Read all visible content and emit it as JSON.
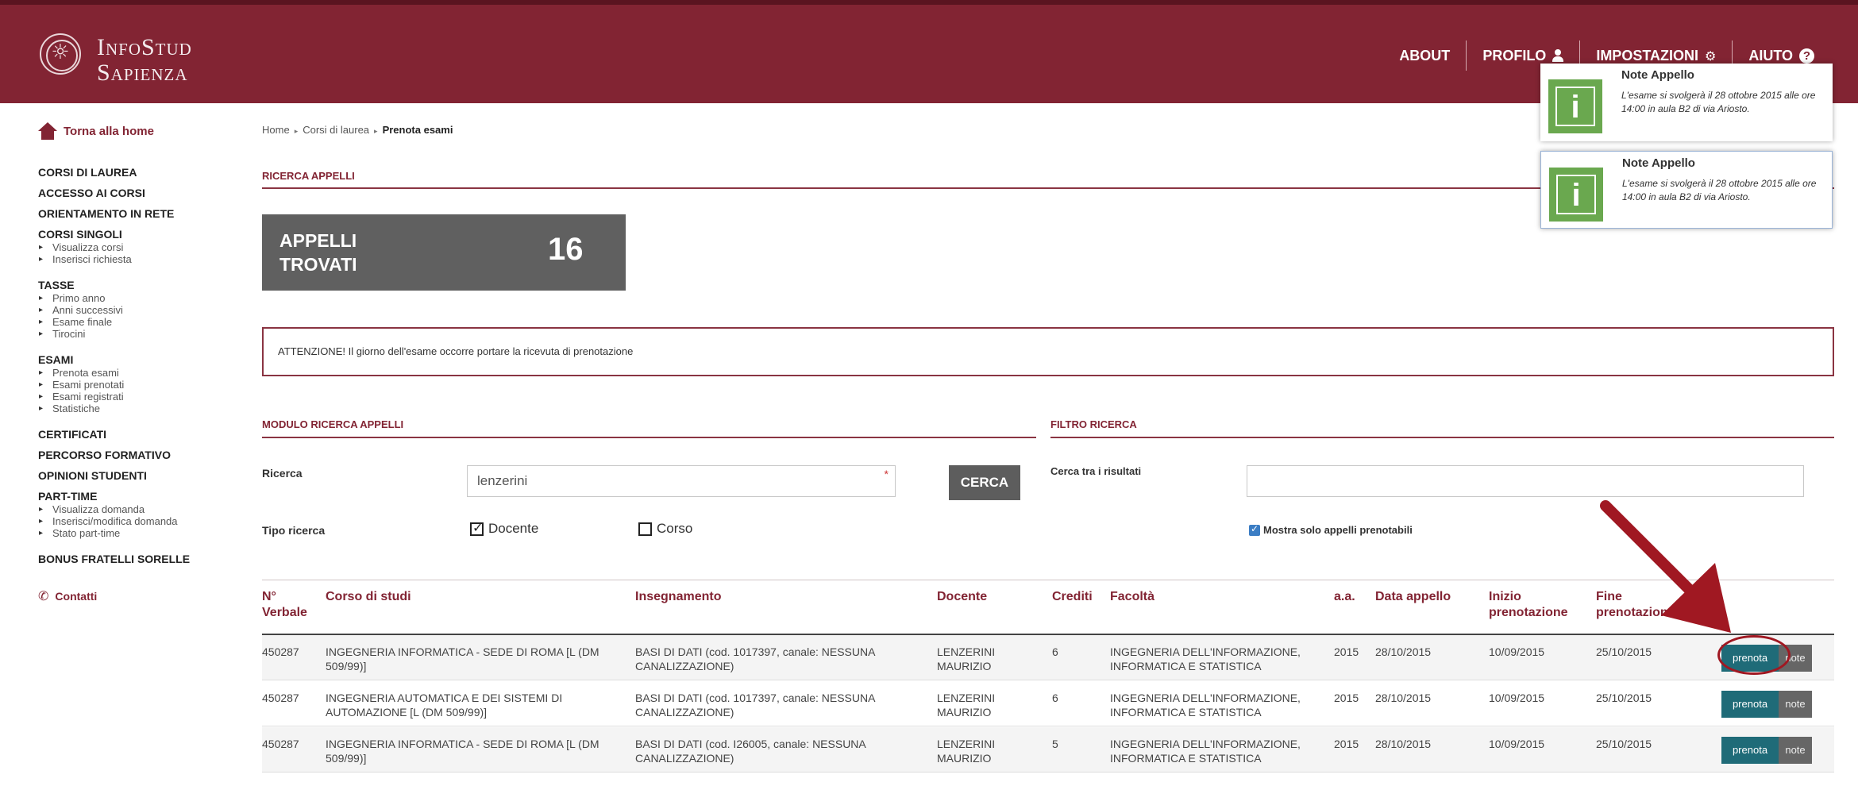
{
  "header": {
    "brand_line1": "InfoStud",
    "brand_line2": "Sapienza",
    "nav": {
      "about": "ABOUT",
      "profilo": "PROFILO",
      "impostazioni": "IMPOSTAZIONI",
      "aiuto": "AIUTO"
    }
  },
  "sidebar": {
    "home": "Torna alla home",
    "corsi_laurea": "CORSI DI LAUREA",
    "accesso": "ACCESSO AI CORSI",
    "orientamento": "ORIENTAMENTO IN RETE",
    "corsi_singoli": "CORSI SINGOLI",
    "corsi_singoli_items": [
      "Visualizza corsi",
      "Inserisci richiesta"
    ],
    "tasse": "TASSE",
    "tasse_items": [
      "Primo anno",
      "Anni successivi",
      "Esame finale",
      "Tirocini"
    ],
    "esami": "ESAMI",
    "esami_items": [
      "Prenota esami",
      "Esami prenotati",
      "Esami registrati",
      "Statistiche"
    ],
    "certificati": "CERTIFICATI",
    "percorso": "PERCORSO FORMATIVO",
    "opinioni": "OPINIONI STUDENTI",
    "part_time": "PART-TIME",
    "part_time_items": [
      "Visualizza domanda",
      "Inserisci/modifica domanda",
      "Stato part-time"
    ],
    "bonus": "BONUS FRATELLI SORELLE",
    "contatti": "Contatti"
  },
  "breadcrumb": {
    "home": "Home",
    "corsi": "Corsi di laurea",
    "current": "Prenota esami"
  },
  "ricerca_appelli": {
    "title": "RICERCA APPELLI",
    "count_label_1": "APPELLI",
    "count_label_2": "TROVATI",
    "count": "16"
  },
  "attention": "ATTENZIONE! Il giorno dell'esame occorre portare la ricevuta di prenotazione",
  "modulo": {
    "title": "MODULO RICERCA APPELLI",
    "ricerca_label": "Ricerca",
    "ricerca_value": "lenzerini",
    "required_mark": "*",
    "cerca": "CERCA",
    "tipo_label": "Tipo ricerca",
    "docente": "Docente",
    "corso": "Corso"
  },
  "filtro": {
    "title": "FILTRO RICERCA",
    "cerca_label": "Cerca tra i risultati",
    "cerca_value": "",
    "mostra": "Mostra solo appelli prenotabili"
  },
  "table": {
    "headers": {
      "verbale_1": "N°",
      "verbale_2": "Verbale",
      "corso": "Corso di studi",
      "insegnamento": "Insegnamento",
      "docente": "Docente",
      "crediti": "Crediti",
      "facolta": "Facoltà",
      "aa": "a.a.",
      "data": "Data appello",
      "inizio_1": "Inizio",
      "inizio_2": "prenotazione",
      "fine_1": "Fine",
      "fine_2": "prenotazione"
    },
    "rows": [
      {
        "verbale": "450287",
        "corso_1": "INGEGNERIA INFORMATICA - SEDE DI ROMA [L (DM",
        "corso_2": "509/99)]",
        "ins_1": "BASI DI DATI (cod. 1017397, canale: NESSUNA",
        "ins_2": "CANALIZZAZIONE)",
        "doc_1": "LENZERINI",
        "doc_2": "MAURIZIO",
        "crediti": "6",
        "fac_1": "INGEGNERIA DELL'INFORMAZIONE,",
        "fac_2": "INFORMATICA E STATISTICA",
        "aa": "2015",
        "data": "28/10/2015",
        "inizio": "10/09/2015",
        "fine": "25/10/2015",
        "prenota": "prenota",
        "note": "note"
      },
      {
        "verbale": "450287",
        "corso_1": "INGEGNERIA AUTOMATICA E DEI SISTEMI DI",
        "corso_2": "AUTOMAZIONE [L (DM 509/99)]",
        "ins_1": "BASI DI DATI (cod. 1017397, canale: NESSUNA",
        "ins_2": "CANALIZZAZIONE)",
        "doc_1": "LENZERINI",
        "doc_2": "MAURIZIO",
        "crediti": "6",
        "fac_1": "INGEGNERIA DELL'INFORMAZIONE,",
        "fac_2": "INFORMATICA E STATISTICA",
        "aa": "2015",
        "data": "28/10/2015",
        "inizio": "10/09/2015",
        "fine": "25/10/2015",
        "prenota": "prenota",
        "note": "note"
      },
      {
        "verbale": "450287",
        "corso_1": "INGEGNERIA INFORMATICA - SEDE DI ROMA [L (DM",
        "corso_2": "509/99)]",
        "ins_1": "BASI DI DATI (cod. I26005, canale: NESSUNA",
        "ins_2": "CANALIZZAZIONE)",
        "doc_1": "LENZERINI",
        "doc_2": "MAURIZIO",
        "crediti": "5",
        "fac_1": "INGEGNERIA DELL'INFORMAZIONE,",
        "fac_2": "INFORMATICA E STATISTICA",
        "aa": "2015",
        "data": "28/10/2015",
        "inizio": "10/09/2015",
        "fine": "25/10/2015",
        "prenota": "prenota",
        "note": "note"
      }
    ]
  },
  "popups": [
    {
      "title": "Note Appello",
      "text": "L'esame si svolgerà il 28 ottobre 2015 alle ore 14:00 in aula B2 di via Ariosto.",
      "icon_letter": "i"
    },
    {
      "title": "Note Appello",
      "text": "L'esame si svolgerà il 28 ottobre 2015 alle ore 14:00 in aula B2 di via Ariosto.",
      "icon_letter": "i"
    }
  ],
  "colors": {
    "brand": "#822433",
    "prenota_button": "#1f6b78",
    "note_button": "#666666",
    "info_icon": "#6aa84f",
    "annotation": "#a01822"
  }
}
